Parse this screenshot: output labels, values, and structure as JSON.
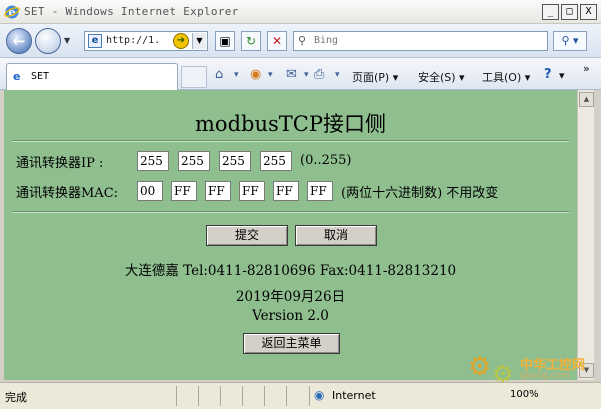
{
  "window": {
    "title": "SET - Windows Internet Explorer",
    "buttons": [
      "_",
      "□",
      "X"
    ]
  },
  "nav": {
    "address_text": "http://1.",
    "search_placeholder": "Bing"
  },
  "cmdbar": {
    "tab_label": "SET",
    "page_menu": "页面(P) ▾",
    "safety_menu": "安全(S) ▾",
    "tools_menu": "工具(O) ▾",
    "help_menu": "▾",
    "overflow": "»"
  },
  "page": {
    "heading": "modbusTCP接口侧",
    "ip_label": "通讯转换器IP :",
    "ip": [
      "255",
      "255",
      "255",
      "255"
    ],
    "ip_range": "(0..255)",
    "mac_label": "通讯转换器MAC:",
    "mac": [
      "00",
      "FF",
      "FF",
      "FF",
      "FF",
      "FF"
    ],
    "mac_note": "(两位十六进制数) 不用改变",
    "submit_label": "提交",
    "cancel_label": "取消",
    "contact": "大连德嘉 Tel:0411-82810696 Fax:0411-82813210",
    "date": "2019年09月26日",
    "version": "Version 2.0",
    "back_label": "返回主菜单"
  },
  "status": {
    "text": "完成",
    "zone": "Internet",
    "zoom": "100%"
  },
  "watermark": {
    "line1": "中华工控网",
    "line2": "gkong.com"
  }
}
